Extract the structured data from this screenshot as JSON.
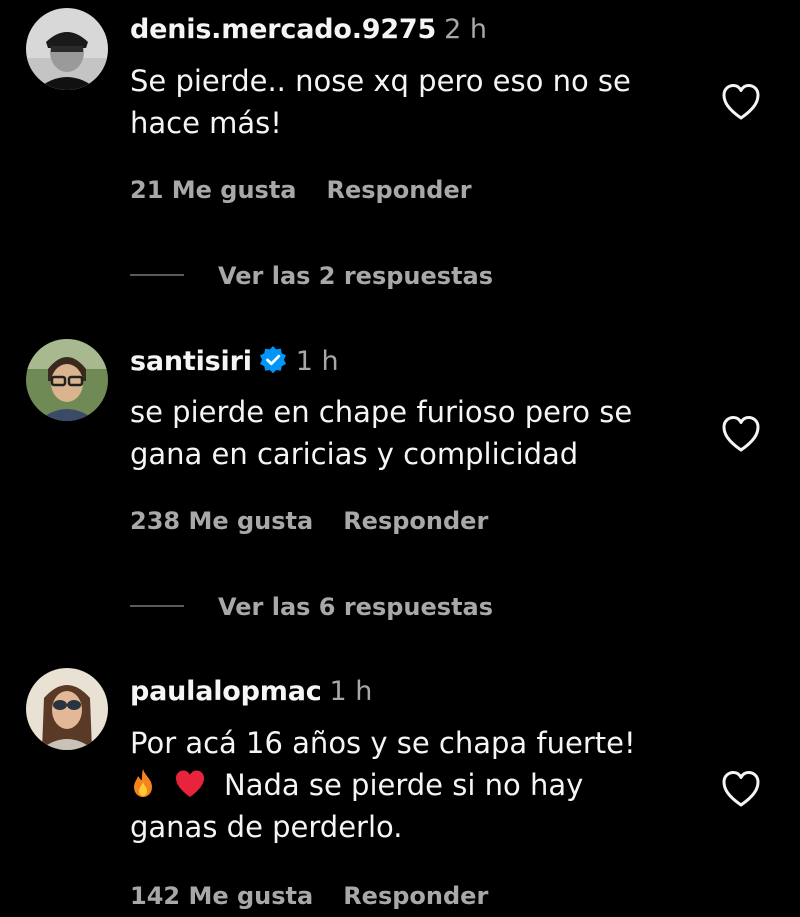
{
  "comments": [
    {
      "username": "denis.mercado.9275",
      "time": "2 h",
      "verified": false,
      "lines": [
        "Se pierde.. nose xq pero eso no se",
        "hace más!"
      ],
      "likes": "21 Me gusta",
      "reply_label": "Responder",
      "view_replies": "Ver las 2 respuestas"
    },
    {
      "username": "santisiri",
      "time": "1 h",
      "verified": true,
      "lines": [
        "se pierde en chape furioso pero se",
        "gana en caricias y complicidad"
      ],
      "likes": "238 Me gusta",
      "reply_label": "Responder",
      "view_replies": "Ver las 6 respuestas"
    },
    {
      "username": "paulalopmac",
      "time": "1 h",
      "verified": false,
      "lines": [
        "Por acá 16 años y se chapa fuerte!",
        "Nada se pierde si no hay",
        "ganas de perderlo."
      ],
      "likes": "142 Me gusta",
      "reply_label": "Responder"
    }
  ],
  "icons": {
    "like": "heart-outline-icon",
    "verified": "verified-badge-icon",
    "emoji_1": "fire-emoji",
    "emoji_2": "red-heart-emoji"
  },
  "colors": {
    "background": "#000000",
    "text": "#f5f5f5",
    "secondary": "#a8a8a8",
    "verified": "#0095f6"
  }
}
